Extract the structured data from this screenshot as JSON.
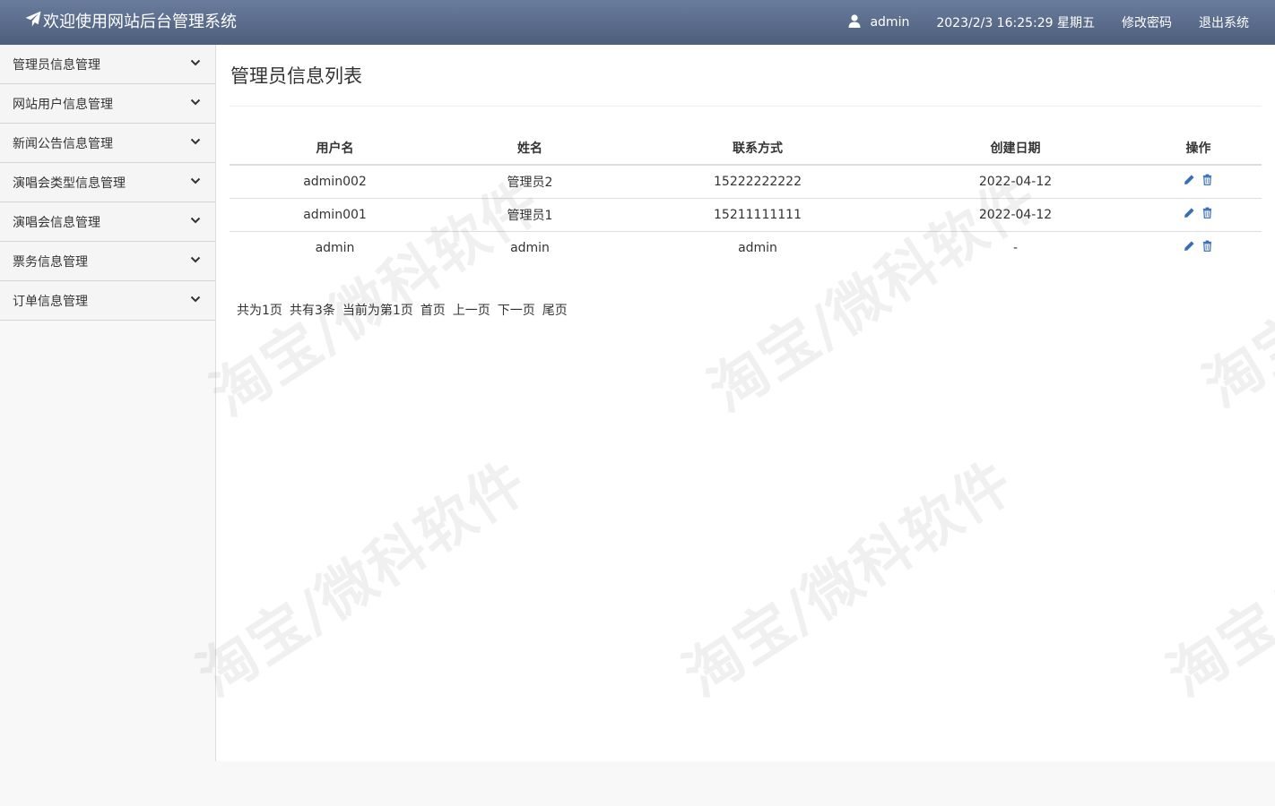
{
  "header": {
    "title": "欢迎使用网站后台管理系统",
    "username": "admin",
    "datetime": "2023/2/3 16:25:29 星期五",
    "change_password": "修改密码",
    "logout": "退出系统"
  },
  "sidebar": {
    "items": [
      {
        "label": "管理员信息管理"
      },
      {
        "label": "网站用户信息管理"
      },
      {
        "label": "新闻公告信息管理"
      },
      {
        "label": "演唱会类型信息管理"
      },
      {
        "label": "演唱会信息管理"
      },
      {
        "label": "票务信息管理"
      },
      {
        "label": "订单信息管理"
      }
    ]
  },
  "main": {
    "title": "管理员信息列表",
    "columns": [
      "用户名",
      "姓名",
      "联系方式",
      "创建日期",
      "操作"
    ],
    "rows": [
      {
        "username": "admin002",
        "name": "管理员2",
        "phone": "15222222222",
        "created": "2022-04-12"
      },
      {
        "username": "admin001",
        "name": "管理员1",
        "phone": "15211111111",
        "created": "2022-04-12"
      },
      {
        "username": "admin",
        "name": "admin",
        "phone": "admin",
        "created": "-"
      }
    ],
    "pagination": {
      "total_pages": "共为1页",
      "total_records": "共有3条",
      "current": "当前为第1页",
      "first": "首页",
      "prev": "上一页",
      "next": "下一页",
      "last": "尾页"
    }
  },
  "watermark": {
    "text": "淘宝/微科软件"
  },
  "icons": {
    "brand": "paper-plane-icon",
    "user": "user-icon",
    "chevron": "chevron-down-icon",
    "edit": "pencil-icon",
    "delete": "trash-icon"
  },
  "colors": {
    "header_top": "#6a7c9c",
    "header_bottom": "#4d5d7c",
    "action_icon": "#3a6fb5"
  }
}
